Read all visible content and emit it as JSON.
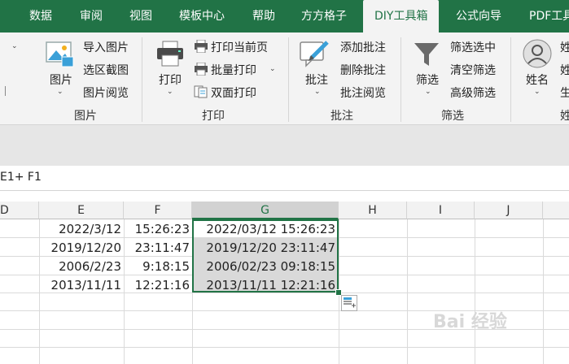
{
  "tabs": [
    "数据",
    "审阅",
    "视图",
    "模板中心",
    "帮助",
    "方方格子",
    "DIY工具箱",
    "公式向导",
    "PDF工具"
  ],
  "active_tab_index": 6,
  "ribbon": {
    "image_group": {
      "big_label": "图片",
      "items": [
        "导入图片",
        "选区截图",
        "图片阅览"
      ],
      "group_label": "图片"
    },
    "print_group": {
      "big_label": "打印",
      "items": [
        "打印当前页",
        "批量打印",
        "双面打印"
      ],
      "group_label": "打印"
    },
    "comment_group": {
      "big_label": "批注",
      "items": [
        "添加批注",
        "删除批注",
        "批注阅览"
      ],
      "group_label": "批注"
    },
    "filter_group": {
      "big_label": "筛选",
      "items": [
        "筛选选中",
        "清空筛选",
        "高级筛选"
      ],
      "group_label": "筛选"
    },
    "name_group": {
      "big_label": "姓名",
      "items": [
        "姓",
        "姓",
        "生"
      ],
      "group_label": "姓"
    }
  },
  "formula_bar": {
    "text": "E1+ F1"
  },
  "columns": [
    "D",
    "E",
    "F",
    "G",
    "H",
    "I",
    "J"
  ],
  "selected_column": "G",
  "rows": [
    {
      "e": "2022/3/12",
      "f": "15:26:23",
      "g": "2022/03/12 15:26:23"
    },
    {
      "e": "2019/12/20",
      "f": "23:11:47",
      "g": "2019/12/20 23:11:47"
    },
    {
      "e": "2006/2/23",
      "f": "9:18:15",
      "g": "2006/02/23 09:18:15"
    },
    {
      "e": "2013/11/11",
      "f": "12:21:16",
      "g": "2013/11/11 12:21:16"
    }
  ],
  "watermark": "Bai 经验",
  "colors": {
    "accent": "#217346",
    "ribbon_bg": "#f3f3f3",
    "selection": "#d9d9d9"
  }
}
